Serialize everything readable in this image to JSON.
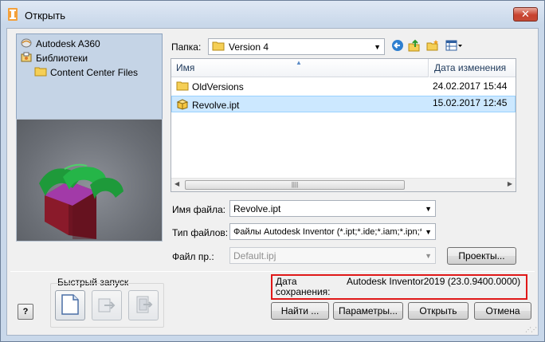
{
  "window": {
    "title": "Открыть",
    "close_glyph": "✕"
  },
  "places": [
    {
      "label": "Autodesk A360",
      "icon": "cloud-icon"
    },
    {
      "label": "Библиотеки",
      "icon": "library-icon"
    },
    {
      "label": "Content Center Files",
      "icon": "folder-icon"
    }
  ],
  "folder": {
    "label": "Папка:",
    "value": "Version 4"
  },
  "filelist": {
    "columns": [
      {
        "label": "Имя"
      },
      {
        "label": "Дата изменения"
      }
    ],
    "rows": [
      {
        "name": "OldVersions",
        "date": "24.02.2017 15:44",
        "icon": "folder-icon",
        "selected": false
      },
      {
        "name": "Revolve.ipt",
        "date": "15.02.2017 12:45",
        "icon": "inventor-part-icon",
        "selected": true
      }
    ]
  },
  "fields": {
    "filename_label": "Имя файла:",
    "filename_value": "Revolve.ipt",
    "filetype_label": "Тип файлов:",
    "filetype_value": "Файлы Autodesk Inventor (*.ipt;*.ide;*.iam;*.ipn;*.",
    "project_label": "Файл пр.:",
    "project_value": "Default.ipj"
  },
  "buttons": {
    "projects": "Проекты...",
    "find": "Найти ...",
    "options": "Параметры...",
    "open": "Открыть",
    "cancel": "Отмена",
    "help": "?"
  },
  "quick_launch": {
    "label": "Быстрый запуск"
  },
  "save_info": {
    "label_line1": "Дата",
    "label_line2": "сохранения:",
    "value": "Autodesk Inventor2019 (23.0.9400.0000)"
  },
  "colors": {
    "highlight_border": "#e01818",
    "selection": "#cce8ff",
    "close_red": "#c8422f"
  }
}
